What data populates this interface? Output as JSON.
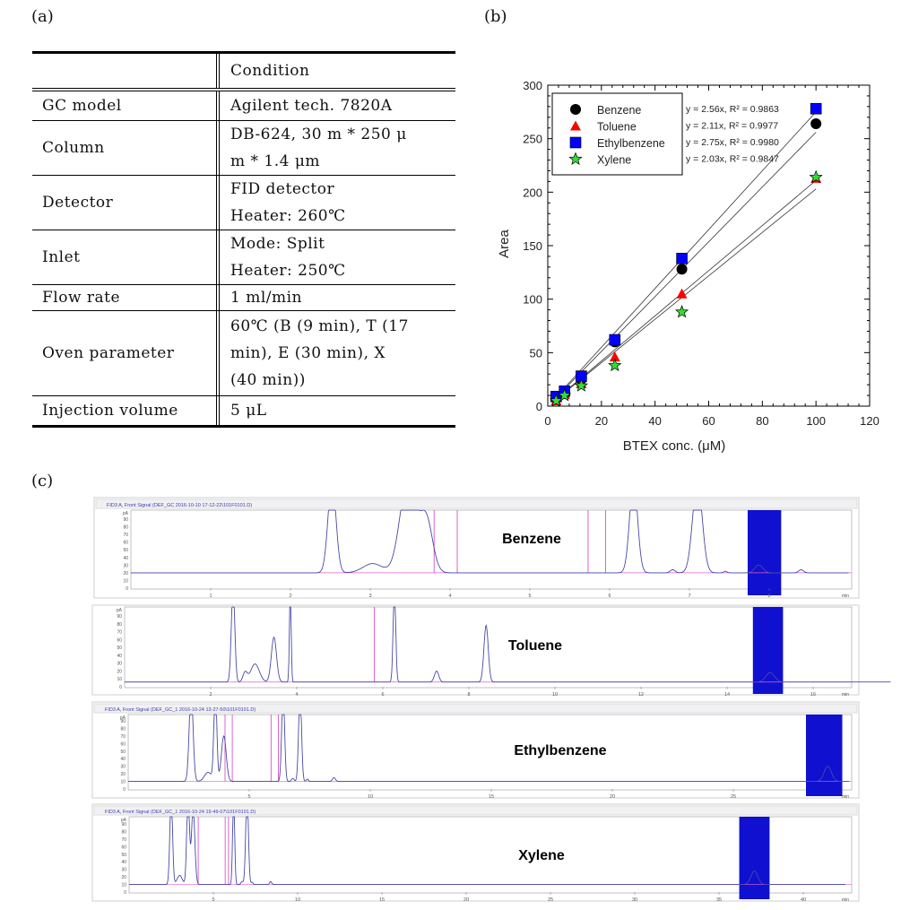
{
  "panel_labels": {
    "a": "(a)",
    "b": "(b)",
    "c": "(c)"
  },
  "table": {
    "header": [
      "",
      "Condition"
    ],
    "rows": [
      {
        "label": "GC model",
        "value": [
          "Agilent tech. 7820A"
        ]
      },
      {
        "label": "Column",
        "value": [
          "DB-624, 30 m * 250 μ",
          "m * 1.4 μm"
        ]
      },
      {
        "label": "Detector",
        "value": [
          "FID detector",
          "Heater: 260℃"
        ]
      },
      {
        "label": "Inlet",
        "value": [
          "Mode: Split",
          "Heater: 250℃"
        ]
      },
      {
        "label": "Flow rate",
        "value": [
          "1 ml/min"
        ]
      },
      {
        "label": "Oven parameter",
        "value": [
          "60℃ (B (9 min), T (17",
          "min), E (30 min), X",
          "(40 min))"
        ]
      },
      {
        "label": "Injection volume",
        "value": [
          "5 μL"
        ]
      }
    ]
  },
  "chart_data": [
    {
      "type": "scatter",
      "xlabel": "BTEX conc. (μM)",
      "ylabel": "Area",
      "xlim": [
        0,
        120
      ],
      "ylim": [
        0,
        300
      ],
      "xticks": [
        0,
        20,
        40,
        60,
        80,
        100,
        120
      ],
      "yticks": [
        0,
        50,
        100,
        150,
        200,
        250,
        300
      ],
      "grid": false,
      "legend": "top-left",
      "x": [
        3.125,
        6.25,
        12.5,
        25,
        50,
        100
      ],
      "series": [
        {
          "name": "Benzene",
          "marker": "circle",
          "color": "#000000",
          "values": [
            9,
            13,
            25,
            60,
            128,
            264
          ],
          "fit": "y = 2.56x, R² = 0.9863",
          "slope": 2.56
        },
        {
          "name": "Toluene",
          "marker": "triangle",
          "color": "#ff0000",
          "values": [
            5,
            11,
            21,
            46,
            105,
            213
          ],
          "fit": "y = 2.11x, R² = 0.9977",
          "slope": 2.11
        },
        {
          "name": "Ethylbenzene",
          "marker": "square",
          "color": "#0000ff",
          "values": [
            9,
            14,
            28,
            62,
            138,
            278
          ],
          "fit": "y = 2.75x, R² = 0.9980",
          "slope": 2.75
        },
        {
          "name": "Xylene",
          "marker": "star",
          "color": "#33dd33",
          "values": [
            5,
            10,
            19,
            38,
            88,
            214
          ],
          "fit": "y = 2.03x, R² = 0.9847",
          "slope": 2.03
        }
      ]
    },
    {
      "type": "line",
      "title": "Benzene",
      "header": "FID3 A, Front Signal (DEF_GC 2016-10-10 17-12-22\\101F0101.D)",
      "ylabel": "pA",
      "xlabel": "min",
      "xticks": [
        1,
        2,
        3,
        4,
        5,
        6,
        7,
        8
      ],
      "yticks": [
        0,
        10,
        20,
        30,
        40,
        50,
        60,
        70,
        80,
        90
      ],
      "xlim": [
        0,
        9
      ],
      "baseline": 20,
      "peaks": [
        [
          2.52,
          120,
          0.05
        ],
        [
          3.03,
          12,
          0.12
        ],
        [
          3.47,
          120,
          0.1
        ],
        [
          3.7,
          70,
          0.08
        ],
        [
          6.3,
          120,
          0.05
        ],
        [
          6.79,
          4,
          0.03
        ],
        [
          7.1,
          120,
          0.06
        ],
        [
          7.45,
          2,
          0.02
        ],
        [
          7.87,
          10,
          0.05
        ],
        [
          8.4,
          4,
          0.03
        ]
      ],
      "markers": [
        3.8,
        4.09,
        5.73,
        5.95
      ],
      "highlight": [
        7.73,
        8.15
      ],
      "highlight_color": "#1010d0"
    },
    {
      "type": "line",
      "title": "Toluene",
      "header": "",
      "ylabel": "pA",
      "xlabel": "min",
      "xticks": [
        2,
        4,
        6,
        8,
        10,
        12,
        14,
        16
      ],
      "yticks": [
        0,
        10,
        20,
        30,
        40,
        50,
        60,
        70,
        80,
        90
      ],
      "xlim": [
        0,
        17.8
      ],
      "baseline": 6,
      "peaks": [
        [
          2.52,
          120,
          0.04
        ],
        [
          2.8,
          12,
          0.05
        ],
        [
          3.03,
          23,
          0.1
        ],
        [
          3.47,
          57,
          0.06
        ],
        [
          3.85,
          120,
          0.02
        ],
        [
          6.27,
          120,
          0.03
        ],
        [
          7.25,
          14,
          0.05
        ],
        [
          8.4,
          72,
          0.05
        ],
        [
          15.0,
          12,
          0.1
        ]
      ],
      "markers": [
        5.8
      ],
      "highlight": [
        14.6,
        15.3
      ],
      "highlight_color": "#1010d0"
    },
    {
      "type": "line",
      "title": "Ethylbenzene",
      "header": "FID3 A, Front Signal (DEF_GC_1 2016-10-24 13-27-50\\101F0101.D)",
      "ylabel": "pA",
      "xlabel": "min",
      "xticks": [
        5,
        10,
        15,
        20,
        25
      ],
      "yticks": [
        0,
        10,
        20,
        30,
        40,
        50,
        60,
        70,
        80,
        90
      ],
      "xlim": [
        0,
        29.8
      ],
      "baseline": 10,
      "peaks": [
        [
          2.6,
          120,
          0.08
        ],
        [
          3.3,
          12,
          0.15
        ],
        [
          3.6,
          120,
          0.06
        ],
        [
          3.95,
          60,
          0.1
        ],
        [
          6.4,
          120,
          0.06
        ],
        [
          6.8,
          4,
          0.05
        ],
        [
          7.1,
          120,
          0.06
        ],
        [
          7.4,
          3,
          0.04
        ],
        [
          8.5,
          5,
          0.06
        ],
        [
          28.9,
          20,
          0.15
        ]
      ],
      "markers": [
        4.0,
        4.3,
        5.9,
        6.2
      ],
      "highlight": [
        28.0,
        29.5
      ],
      "highlight_color": "#1010d0"
    },
    {
      "type": "line",
      "title": "Xylene",
      "header": "FID3 A, Front Signal (DEF_GC_1 2016-10-24 19-49-07\\101F0101.D)",
      "ylabel": "pA",
      "xlabel": "min",
      "xticks": [
        5,
        10,
        15,
        20,
        25,
        30,
        35,
        40
      ],
      "yticks": [
        0,
        10,
        20,
        30,
        40,
        50,
        60,
        70,
        80,
        90
      ],
      "xlim": [
        0,
        42.5
      ],
      "baseline": 10,
      "peaks": [
        [
          2.5,
          120,
          0.08
        ],
        [
          3.0,
          12,
          0.15
        ],
        [
          3.5,
          120,
          0.08
        ],
        [
          3.8,
          100,
          0.1
        ],
        [
          6.2,
          120,
          0.06
        ],
        [
          6.7,
          4,
          0.06
        ],
        [
          7.0,
          120,
          0.08
        ],
        [
          7.3,
          3,
          0.05
        ],
        [
          8.4,
          4,
          0.06
        ],
        [
          37.1,
          18,
          0.2
        ]
      ],
      "markers": [
        4.1,
        5.7,
        5.9
      ],
      "highlight": [
        36.2,
        38.0
      ],
      "highlight_color": "#1010d0"
    }
  ]
}
